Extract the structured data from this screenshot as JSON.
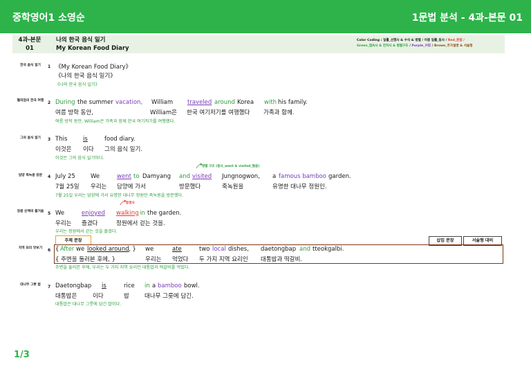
{
  "header": {
    "title_left": "중학영어1 소영순",
    "title_right": "1문법 분석 - 4과-본문 01"
  },
  "info": {
    "lesson_line1": "4과-본문",
    "lesson_line2": "01",
    "title_ko": "나의 한국 음식 일기",
    "title_en": "My Korean Food Diary",
    "color_coding_line1_prefix": "Color Coding : 일률_선행사 & 수식 & 병렬 / 이중 일률_동사 / ",
    "color_coding_red": "Red_문법 /",
    "color_coding_green": "Green_접속사 & 전치사 & 병렬구조",
    "color_coding_sep1": " / ",
    "color_coding_purple": "Purple_어휘",
    "color_coding_sep2": " / ",
    "color_coding_brown": "Brown_추가설명 & 서술형"
  },
  "rows": [
    {
      "label": "한국 음식 일기",
      "num": "1",
      "en": "《My Korean Food Diary》",
      "ko": "《나의 한국 음식 일기》",
      "tr": "《나의 한국 음식 일기》"
    },
    {
      "label": "월리엄의 한국 여행",
      "num": "2",
      "en_during": "During",
      "en_the_summer": "the summer",
      "en_vacation": "vacation,",
      "en_william": "William",
      "en_traveled": "traveled",
      "en_around": "around",
      "en_korea": "Korea",
      "en_with": "with",
      "en_his_family": "his family.",
      "ko_1": "여름 방학 동안,",
      "ko_2": "William은",
      "ko_3": "한국 여기저기를 여행했다",
      "ko_4": "가족과 함께.",
      "tr": "여름 방학 동안, William은 가족과 함께 한국 여기저기를 여행했다."
    },
    {
      "label": "그의 음식 일기",
      "num": "3",
      "en_this": "This",
      "en_is": "is",
      "en_food_diary": "food diary.",
      "ko_1": "이것은",
      "ko_2": "이다",
      "ko_3": "그의 음식 일기.",
      "tr": "이것은 그의 음식 일기이다."
    },
    {
      "label": "담양 죽녹원 방문",
      "num": "4",
      "annotation": "병렬 구조 (동사_went & visited_발음)",
      "en_date": "July 25",
      "en_we": "We",
      "en_went": "went",
      "en_to": "to",
      "en_damyang": "Damyang",
      "en_and": "and",
      "en_visited": "visited",
      "en_jungnogwon": "Jungnogwon,",
      "en_a": "a",
      "en_famous_bamboo": "famous bamboo",
      "en_garden": "garden.",
      "ko_1": "7월 25일",
      "ko_2": "우리는",
      "ko_3": "담양에 가서",
      "ko_4": "방문했다",
      "ko_5": "죽녹원을",
      "ko_6": "유명한 대나무 정원인.",
      "tr": "7월 25일 우리는 담양에 가서 유명한 대나무 정원인 죽녹원을 방문했다."
    },
    {
      "label": "정원 산책의 즐거움",
      "num": "5",
      "annotation": "동명사",
      "en_we": "We",
      "en_enjoyed": "enjoyed",
      "en_walking": "walking",
      "en_in": "in",
      "en_the_garden": "the garden.",
      "ko_1": "우리는",
      "ko_2": "즐겼다",
      "ko_3": "정원에서 걷는 것을.",
      "tr": "우리는 정원에서 걷는 것을 즐겼다."
    },
    {
      "label": "지역 요리 맛보기",
      "num": "6",
      "theme_label": "주제 문장",
      "insert_label": "삽입 문장",
      "essay_label": "서술형 대비",
      "en_open": "{",
      "en_after": "After",
      "en_we_looked": "we",
      "en_looked_around": "looked around",
      "en_close": ", }",
      "en_we": "we",
      "en_ate": "ate",
      "en_two": "two",
      "en_local": "local",
      "en_dishes": "dishes,",
      "en_daetongbap": "daetongbap",
      "en_and": "and",
      "en_tteokgalbi": "tteokgalbi.",
      "ko_1": "{ 주변을 둘러본 후에, }",
      "ko_2": "우리는",
      "ko_3": "먹었다",
      "ko_4": "두 가지 지역 요리인",
      "ko_5": "대통밥과 떡갈비.",
      "tr": "주변을 둘러본 후에, 우리는 두 가지 지역 요리인 대통밥과 떡갈비를 먹었다."
    },
    {
      "label": "대나무 그릇 밥",
      "num": "7",
      "en_daetongbap": "Daetongbap",
      "en_is": "is",
      "en_rice": "rice",
      "en_in": "in",
      "en_a": "a",
      "en_bamboo": "bamboo",
      "en_bowl": "bowl.",
      "ko_1": "대통밥은",
      "ko_2": "이다",
      "ko_3": "밥",
      "ko_4": "대나무 그릇에 담긴.",
      "tr": "대통밥은 대나무 그릇에 담긴 밥이다."
    }
  ],
  "footer": {
    "page": "1/3"
  },
  "colors": {
    "brand": "#2db34a",
    "green": "#2e9e3e",
    "purple": "#7b3cb8",
    "red": "#e53935",
    "orange": "#f0a11f",
    "brown": "#7a3a12"
  }
}
